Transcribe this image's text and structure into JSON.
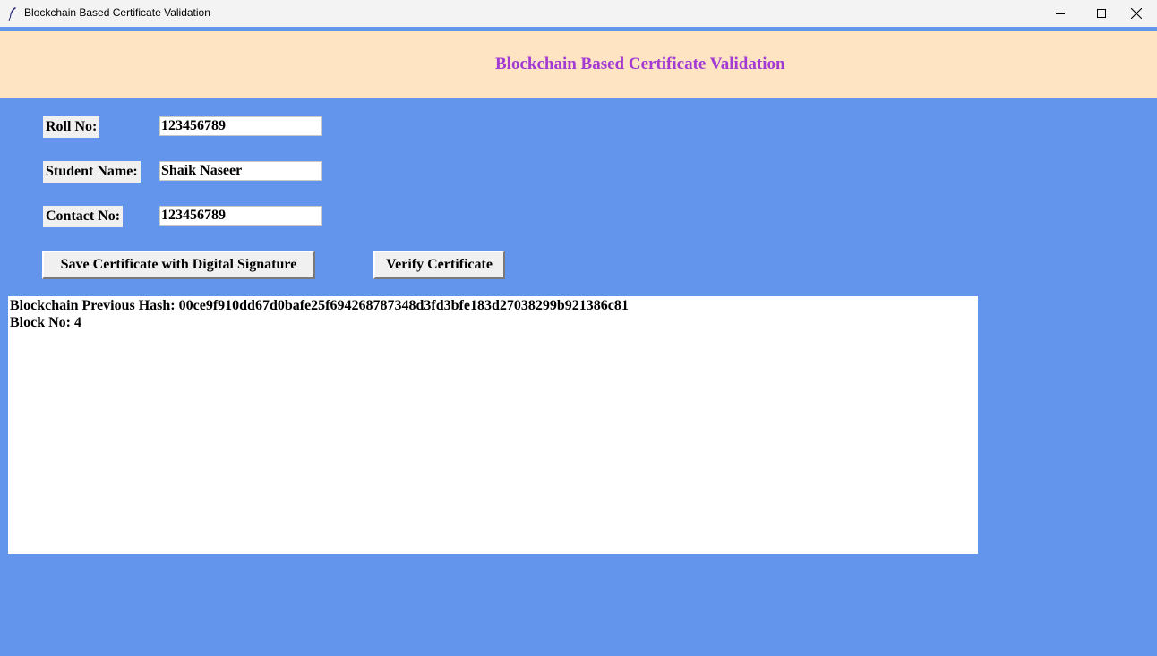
{
  "window": {
    "title": "Blockchain Based Certificate Validation",
    "controls": [
      "minimize-icon",
      "maximize-icon",
      "close-icon"
    ]
  },
  "header": {
    "heading": "Blockchain Based Certificate Validation"
  },
  "form": {
    "roll": {
      "label": "Roll No:",
      "value": "123456789"
    },
    "name": {
      "label": "Student Name:",
      "value": "Shaik Naseer"
    },
    "contact": {
      "label": "Contact No:",
      "value": "123456789"
    }
  },
  "buttons": {
    "save": "Save Certificate with Digital Signature",
    "verify": "Verify Certificate"
  },
  "output": {
    "lines": [
      "Blockchain Previous Hash: 00ce9f910dd67d0bafe25f694268787348d3fd3bfe183d27038299b921386c81",
      "Block No: 4"
    ]
  },
  "colors": {
    "background": "#6495ED",
    "header_bg": "#FFE4C4",
    "heading_text": "#A23AD3"
  }
}
